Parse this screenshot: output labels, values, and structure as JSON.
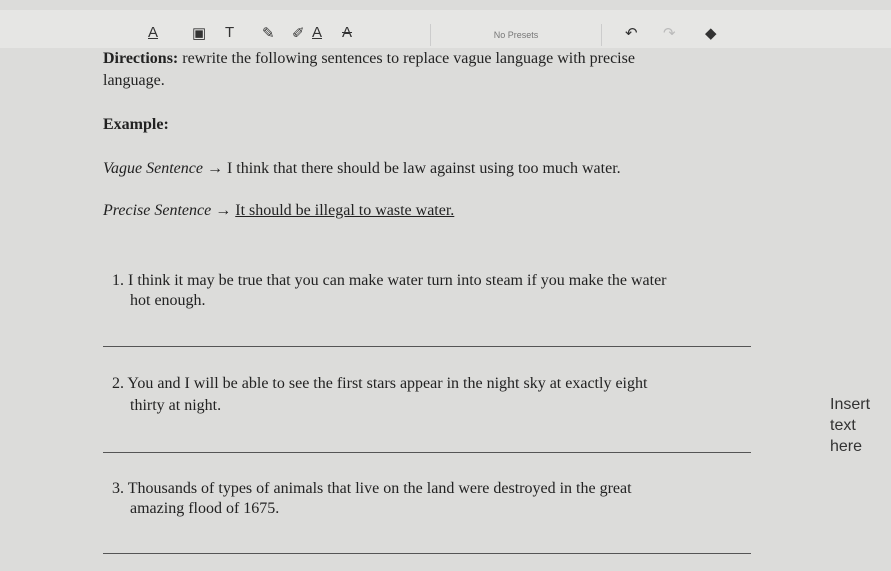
{
  "toolbar": {
    "icons": [
      "text-underline-icon",
      "text-box-icon",
      "text-icon",
      "pen-icon",
      "highlighter-icon",
      "font-color-icon",
      "strikethrough-icon",
      "undo-icon",
      "redo-icon",
      "eraser-icon"
    ],
    "presets": "No Presets"
  },
  "directions_label": "Directions:",
  "directions_text": " rewrite the following sentences to replace vague language with precise",
  "directions_text2": "language.",
  "example_label": "Example:",
  "vague_label": "Vague Sentence",
  "vague_text": " → I think that there should be law against using too much water.",
  "precise_label": "Precise Sentence",
  "precise_arrow": " → ",
  "precise_text": "It should be illegal to waste water.",
  "items": [
    {
      "num": "1.",
      "line1": " I think it may be true that you can make water turn into steam if you make the water",
      "line2": "hot enough."
    },
    {
      "num": "2.",
      "line1": " You and I will be able to see the first stars appear in the night sky at exactly eight",
      "line2": "thirty at night."
    },
    {
      "num": "3.",
      "line1": " Thousands of types of animals that live on the land were destroyed in the great",
      "line2": "amazing flood of 1675."
    }
  ],
  "insert": {
    "l1": "Insert",
    "l2": "text",
    "l3": "here"
  }
}
